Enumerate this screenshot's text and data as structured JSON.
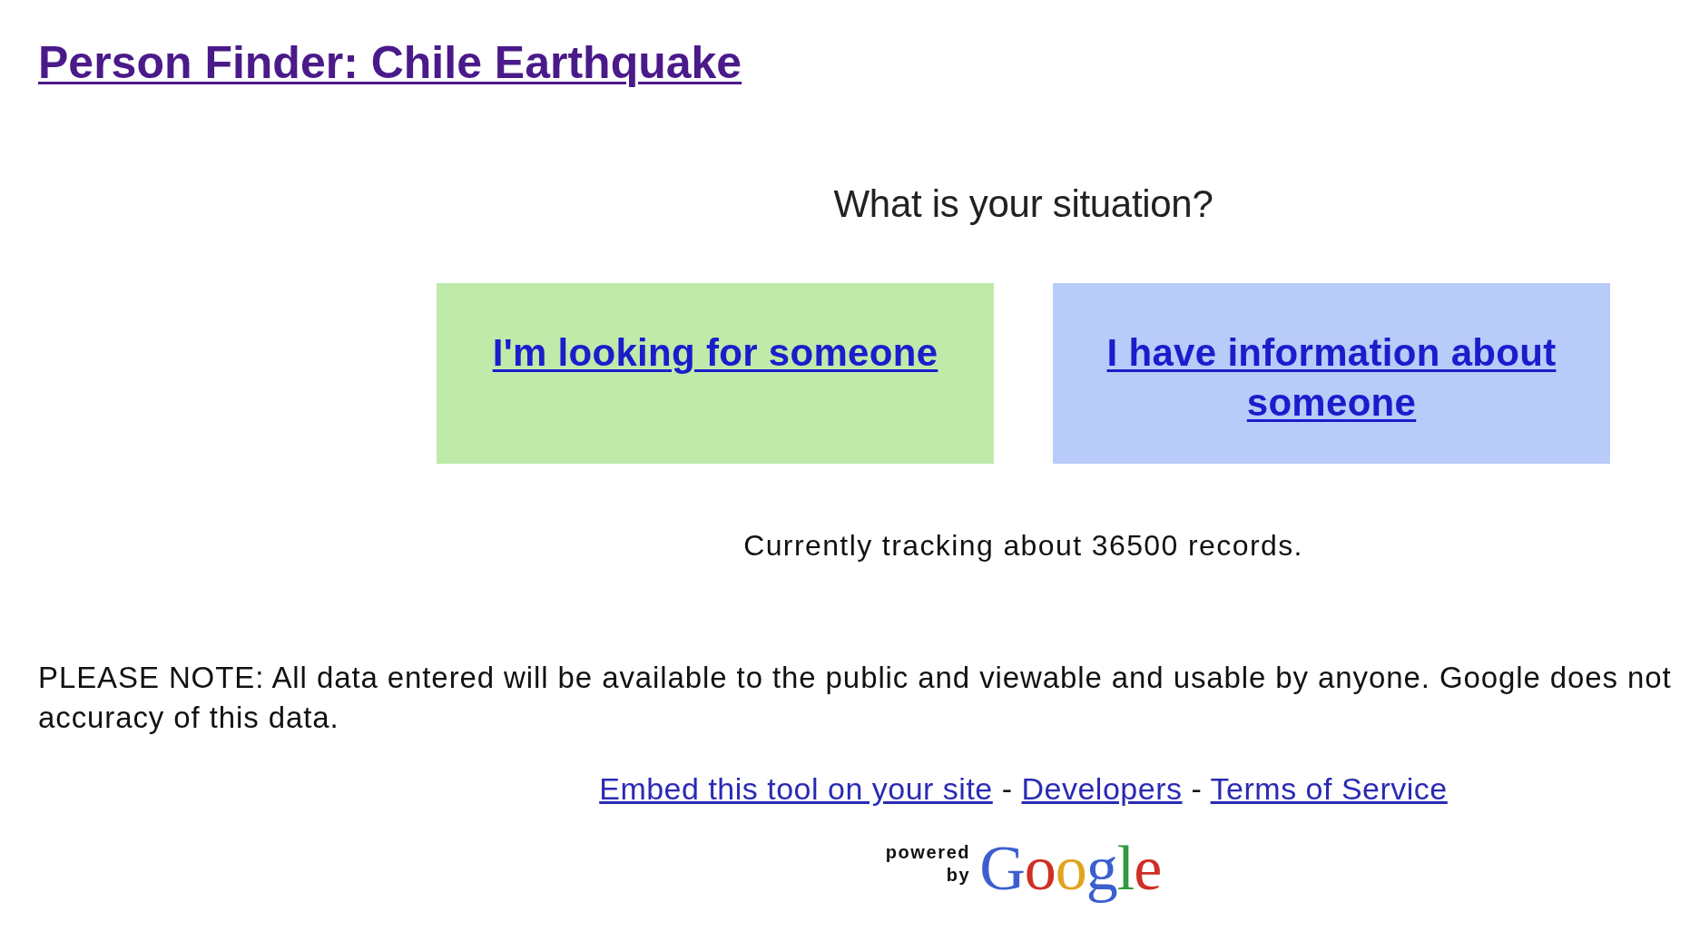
{
  "header": {
    "title": "Person Finder: Chile Earthquake"
  },
  "prompt": "What is your situation?",
  "choices": [
    {
      "label": "I'm looking for someone",
      "color": "#bfeaaa"
    },
    {
      "label": "I have information about someone",
      "color": "#b9cbf8"
    }
  ],
  "stats": "Currently tracking about 36500 records.",
  "notice": {
    "lines": [
      "PLEASE NOTE: All data entered will be available to the public and viewable and usable by anyone. Google does not",
      "accuracy of this data."
    ]
  },
  "footer": {
    "items": [
      {
        "kind": "link",
        "text": "Embed this tool on your site"
      },
      {
        "kind": "separator",
        "text": "-"
      },
      {
        "kind": "link",
        "text": "Developers"
      },
      {
        "kind": "separator",
        "text": "-"
      },
      {
        "kind": "link",
        "text": "Terms of Service"
      }
    ]
  },
  "branding": {
    "powered_by": [
      "powered",
      "by"
    ],
    "logo": "Google"
  }
}
